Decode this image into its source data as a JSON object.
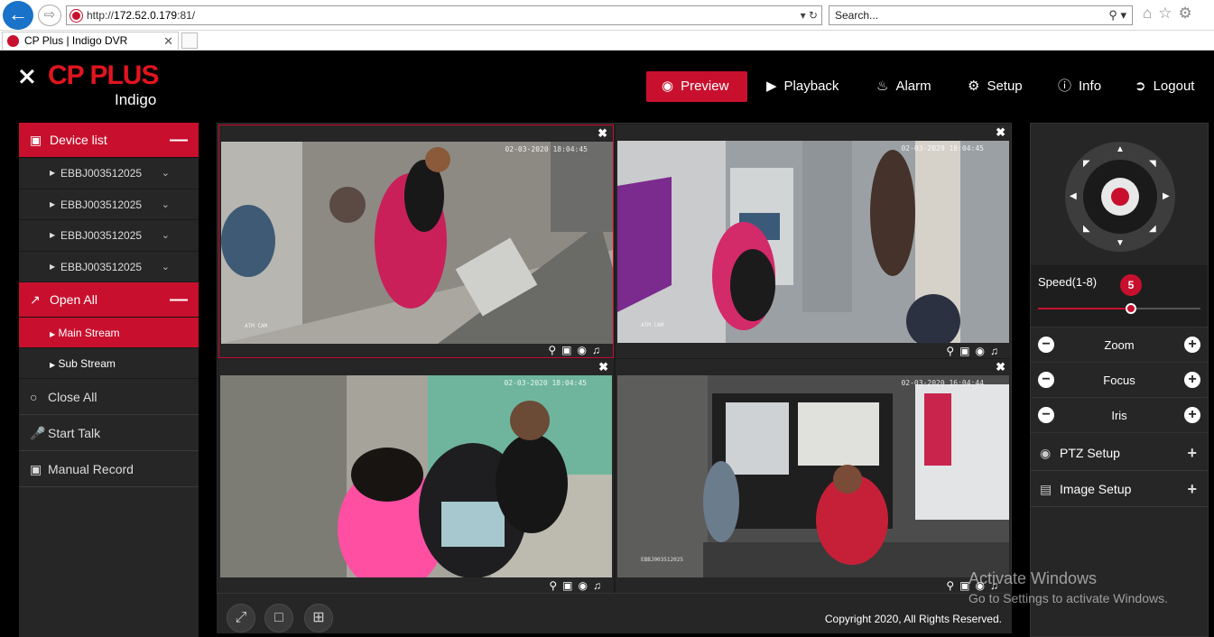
{
  "browser": {
    "url_prefix": "http://",
    "url_host": "172.52.0.179",
    "url_suffix": ":81/",
    "search_placeholder": "Search...",
    "tab_title": "CP Plus | Indigo DVR"
  },
  "brand": {
    "name": "CP PLUS",
    "product": "Indigo",
    "accent_color": "#c8102e"
  },
  "nav": {
    "preview": "Preview",
    "playback": "Playback",
    "alarm": "Alarm",
    "setup": "Setup",
    "info": "Info",
    "logout": "Logout"
  },
  "sidebar": {
    "device_list": "Device list",
    "devices": [
      "EBBJ003512025",
      "EBBJ003512025",
      "EBBJ003512025",
      "EBBJ003512025"
    ],
    "open_all": "Open All",
    "main_stream": "Main Stream",
    "sub_stream": "Sub Stream",
    "close_all": "Close All",
    "start_talk": "Start Talk",
    "manual_record": "Manual Record"
  },
  "cameras": [
    {
      "timestamp": "02-03-2020 18:04:45",
      "label": "ATM CAM"
    },
    {
      "timestamp": "02-03-2020 18:04:45",
      "label": "ATM CAM"
    },
    {
      "timestamp": "02-03-2020 18:04:45",
      "label": ""
    },
    {
      "timestamp": "02-03-2020 16:04:44",
      "label": "EBBJ003512025"
    }
  ],
  "footer": {
    "copyright": "Copyright 2020, All Rights Reserved."
  },
  "ptz": {
    "speed_label": "Speed(1-8)",
    "speed_value": "5",
    "speed_fraction": 0.57,
    "zoom": "Zoom",
    "focus": "Focus",
    "iris": "Iris",
    "ptz_setup": "PTZ Setup",
    "image_setup": "Image Setup"
  },
  "watermark": {
    "line1": "Activate Windows",
    "line2": "Go to Settings to activate Windows."
  }
}
